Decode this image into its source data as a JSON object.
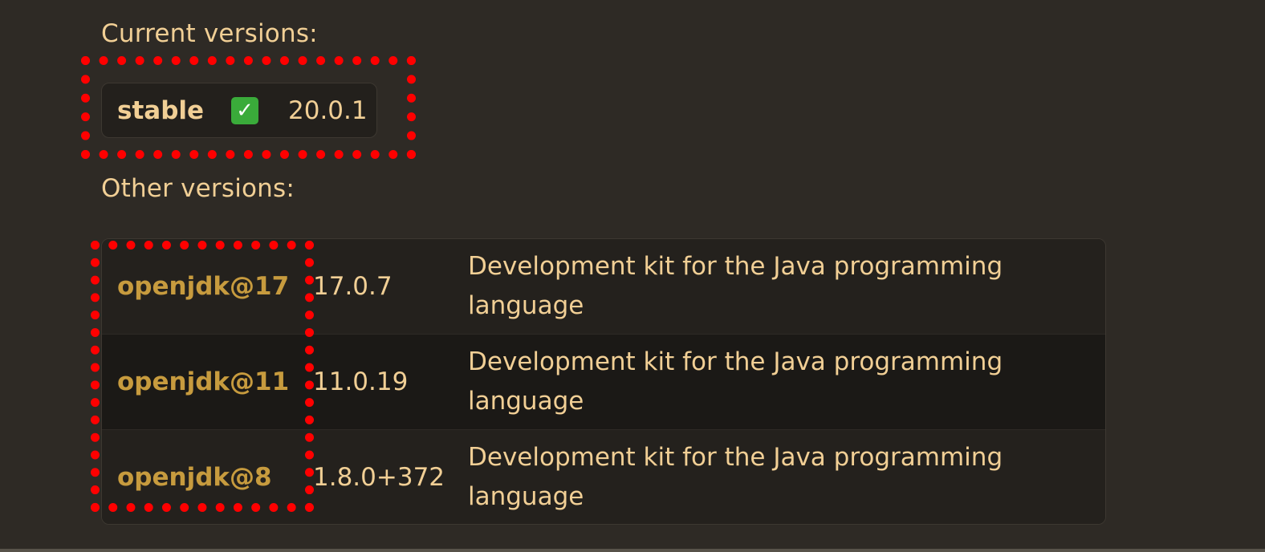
{
  "current_section": {
    "label": "Current versions:",
    "channel": "stable",
    "check_glyph": "✓",
    "version": "20.0.1"
  },
  "other_section": {
    "label": "Other versions:",
    "rows": [
      {
        "name": "openjdk@17",
        "version": "17.0.7",
        "description": "Development kit for the Java programming language"
      },
      {
        "name": "openjdk@11",
        "version": "11.0.19",
        "description": "Development kit for the Java programming language"
      },
      {
        "name": "openjdk@8",
        "version": "1.8.0+372",
        "description": "Development kit for the Java programming language"
      }
    ]
  },
  "colors": {
    "background": "#2e2a25",
    "text": "#f1cf95",
    "link": "#c79b3e",
    "highlight": "#ff0000",
    "check": "#3aab3a"
  },
  "icons": {
    "check": "check-mark-button-icon"
  }
}
